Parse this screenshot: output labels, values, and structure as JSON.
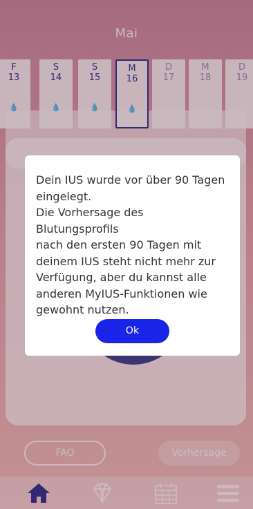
{
  "header": {
    "month": "Mai"
  },
  "calendar": {
    "days": [
      {
        "weekday": "F",
        "date": "13",
        "icon": "drop-icon",
        "state": "past"
      },
      {
        "weekday": "S",
        "date": "14",
        "icon": "drop-icon",
        "state": "past"
      },
      {
        "weekday": "S",
        "date": "15",
        "icon": "drop-icon",
        "state": "past"
      },
      {
        "weekday": "M",
        "date": "16",
        "icon": "drop-icon",
        "state": "selected"
      },
      {
        "weekday": "D",
        "date": "17",
        "icon": "",
        "state": "future"
      },
      {
        "weekday": "M",
        "date": "18",
        "icon": "",
        "state": "future"
      },
      {
        "weekday": "D",
        "date": "19",
        "icon": "",
        "state": "future"
      }
    ]
  },
  "dialog": {
    "message": "Dein IUS wurde vor über 90 Tagen\neingelegt.\nDie Vorhersage des Blutungsprofils\nnach den ersten 90 Tagen mit\ndeinem IUS steht nicht mehr zur\nVerfügung, aber du kannst alle\nanderen MyIUS-Funktionen wie\ngewohnt nutzen.",
    "ok_label": "Ok"
  },
  "actions": {
    "faq_label": "FAQ",
    "forecast_label": "Vorhersage"
  },
  "tabbar": {
    "items": [
      {
        "icon": "home-icon",
        "active": true
      },
      {
        "icon": "diamond-icon",
        "active": false
      },
      {
        "icon": "calendar-icon",
        "active": false
      },
      {
        "icon": "menu-icon",
        "active": false
      }
    ]
  },
  "colors": {
    "accent": "#1a23e8",
    "navy": "#1e2a8c",
    "background_top": "#c98aa0",
    "background_bottom": "#f4c3bf"
  }
}
